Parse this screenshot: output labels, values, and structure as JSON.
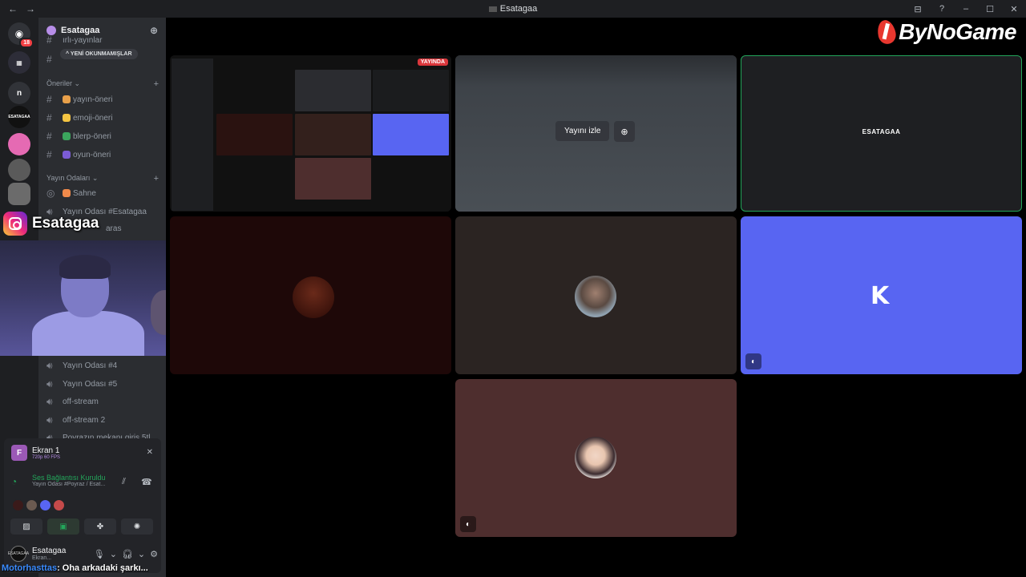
{
  "window": {
    "title": "Esatagaa",
    "back_label": "←",
    "forward_label": "→",
    "inbox_icon": "⊟",
    "help_icon": "?",
    "min_label": "–",
    "max_label": "☐",
    "close_label": "✕"
  },
  "brand": {
    "text": "ByNoGame"
  },
  "servers": {
    "home_badge": "18",
    "items": [
      {
        "label": "n",
        "color": "#313338"
      },
      {
        "label": "ESATAGAA",
        "color": "#111111"
      },
      {
        "label": "",
        "color": "#e56ab3"
      },
      {
        "label": "",
        "color": "#5a5a5a"
      },
      {
        "label": "",
        "color": "#6b6b6b"
      }
    ]
  },
  "guild": {
    "name": "Esatagaa",
    "unread_pill": "YENİ OKUNMAMIŞLAR",
    "categories": {
      "oneriler": "Öneriler",
      "yayin_odalari": "Yayın Odaları"
    },
    "suggestion_channels": [
      {
        "emoji_color": "#e8a04a",
        "name": "yayın-öneri"
      },
      {
        "emoji_color": "#f5c542",
        "name": "emoji-öneri"
      },
      {
        "emoji_color": "#3ba55d",
        "name": "blerp-öneri"
      },
      {
        "emoji_color": "#7b5cd6",
        "name": "oyun-öneri"
      }
    ],
    "stage_channel": {
      "name": "Sahne"
    },
    "voice_channels": [
      {
        "name": "Yayın Odası #Esatagaa",
        "top_offset": 0
      },
      {
        "name": "Yayın Odası #4"
      },
      {
        "name": "Yayın Odası #5"
      },
      {
        "name": "off-stream"
      },
      {
        "name": "off-stream 2"
      },
      {
        "name": "Poyrazın mekanı giriş 5tl"
      }
    ],
    "partial_top": "ırlı-yayınlar",
    "partial_aras": "aras"
  },
  "overlay": {
    "instagram_name": "Esatagaa",
    "chat_user": "Motorhasttas",
    "chat_message": ": Oha arkadaki şarkı..."
  },
  "panel": {
    "stream_title": "Ekran 1",
    "stream_quality": "720p 60 FPS",
    "voice_status": "Ses Bağlantısı Kuruldu",
    "voice_channel": "Yayın Odası #Poyraz / Esat...",
    "participants": [
      "#3a1a1a",
      "#6b5a50",
      "#5865f2",
      "#c44a4a"
    ],
    "me_name": "Esatagaa",
    "me_status": "Ekran...",
    "me_avatar_text": "ESATAGAA"
  },
  "tiles": {
    "live_badge": "YAYINDA",
    "watch_label": "Yayını izle",
    "esatagaa_label": "ESATAGAA",
    "k_letter": "K"
  },
  "colors": {
    "discord_bg": "#2b2d31",
    "accent": "#5865f2",
    "green": "#23a55a",
    "red": "#da373c"
  }
}
